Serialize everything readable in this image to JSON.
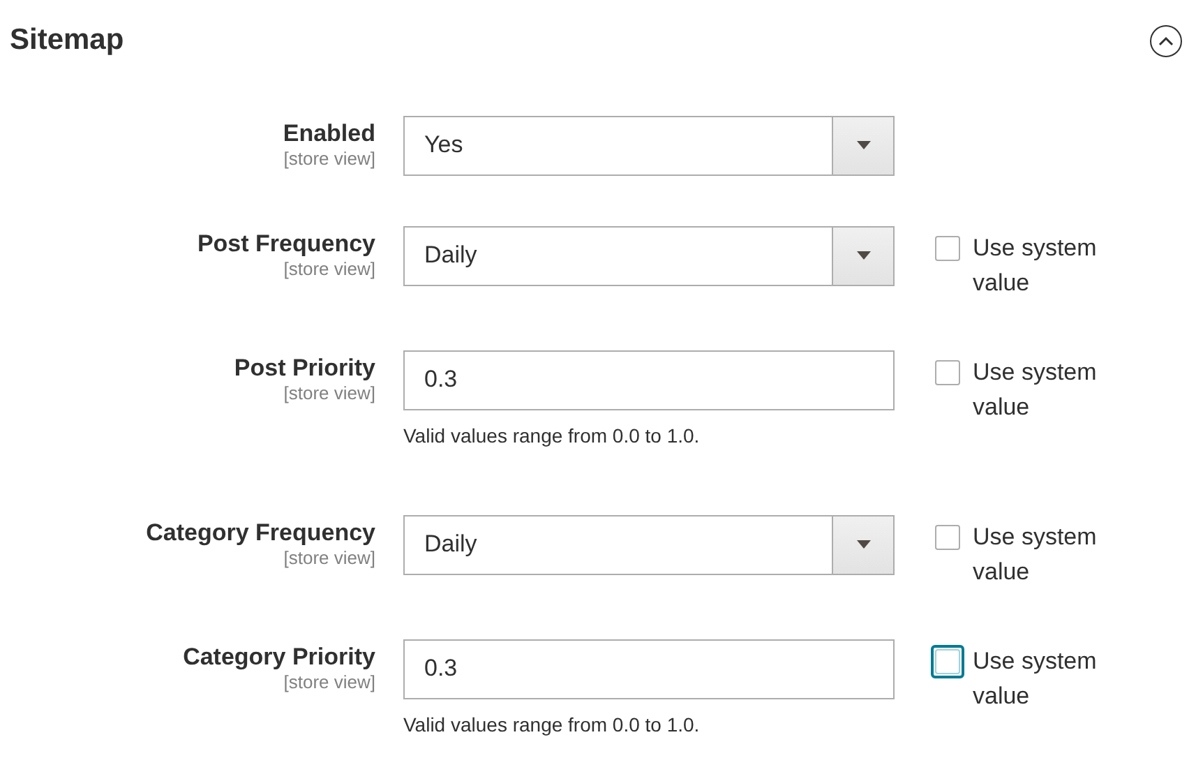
{
  "section": {
    "title": "Sitemap",
    "expanded": true
  },
  "fields": [
    {
      "kind": "select",
      "label": "Enabled",
      "scope": "[store view]",
      "value": "Yes"
    },
    {
      "kind": "select",
      "label": "Post Frequency",
      "scope": "[store view]",
      "value": "Daily",
      "system": {
        "label": "Use system value",
        "checked": false
      }
    },
    {
      "kind": "text",
      "label": "Post Priority",
      "scope": "[store view]",
      "value": "0.3",
      "note": "Valid values range from 0.0 to 1.0.",
      "system": {
        "label": "Use system value",
        "checked": false
      }
    },
    {
      "kind": "select",
      "label": "Category Frequency",
      "scope": "[store view]",
      "value": "Daily",
      "system": {
        "label": "Use system value",
        "checked": false
      }
    },
    {
      "kind": "text",
      "label": "Category Priority",
      "scope": "[store view]",
      "value": "0.3",
      "note": "Valid values range from 0.0 to 1.0.",
      "system": {
        "label": "Use system value",
        "checked": false,
        "focused": true
      }
    }
  ]
}
